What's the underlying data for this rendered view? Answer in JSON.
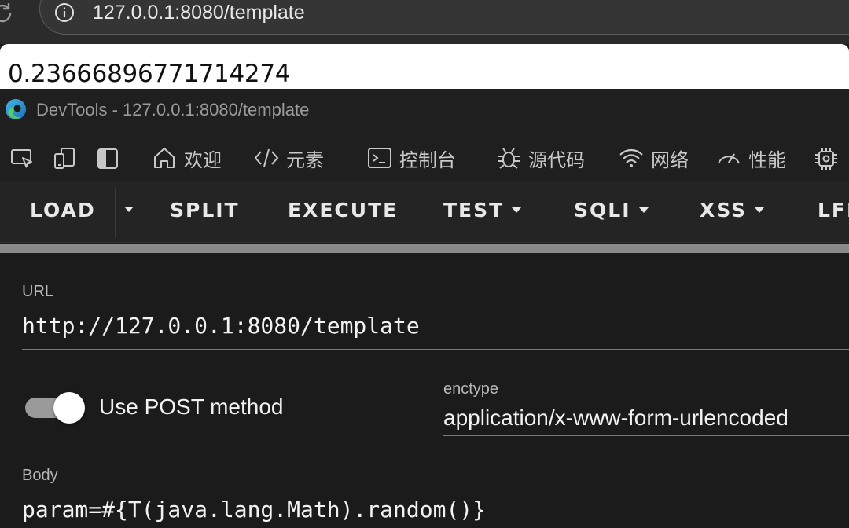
{
  "browser": {
    "address": "127.0.0.1:8080/template"
  },
  "page": {
    "output": "0.23666896771714274"
  },
  "devtools": {
    "title": "DevTools - 127.0.0.1:8080/template",
    "tabs": [
      {
        "label": "欢迎",
        "icon": "home-icon"
      },
      {
        "label": "元素",
        "icon": "code-icon"
      },
      {
        "label": "控制台",
        "icon": "console-icon"
      },
      {
        "label": "源代码",
        "icon": "bug-icon"
      },
      {
        "label": "网络",
        "icon": "wifi-icon"
      },
      {
        "label": "性能",
        "icon": "gauge-icon"
      }
    ]
  },
  "hackbar": {
    "menu": {
      "load": "LOAD",
      "split": "SPLIT",
      "execute": "EXECUTE",
      "test": "TEST",
      "sqli": "SQLI",
      "xss": "XSS",
      "lfi": "LFI"
    },
    "url_label": "URL",
    "url_value": "http://127.0.0.1:8080/template",
    "post_toggle_label": "Use POST method",
    "post_enabled": true,
    "enctype_label": "enctype",
    "enctype_value": "application/x-www-form-urlencoded",
    "body_label": "Body",
    "body_value": "param=#{T(java.lang.Math).random()}"
  }
}
